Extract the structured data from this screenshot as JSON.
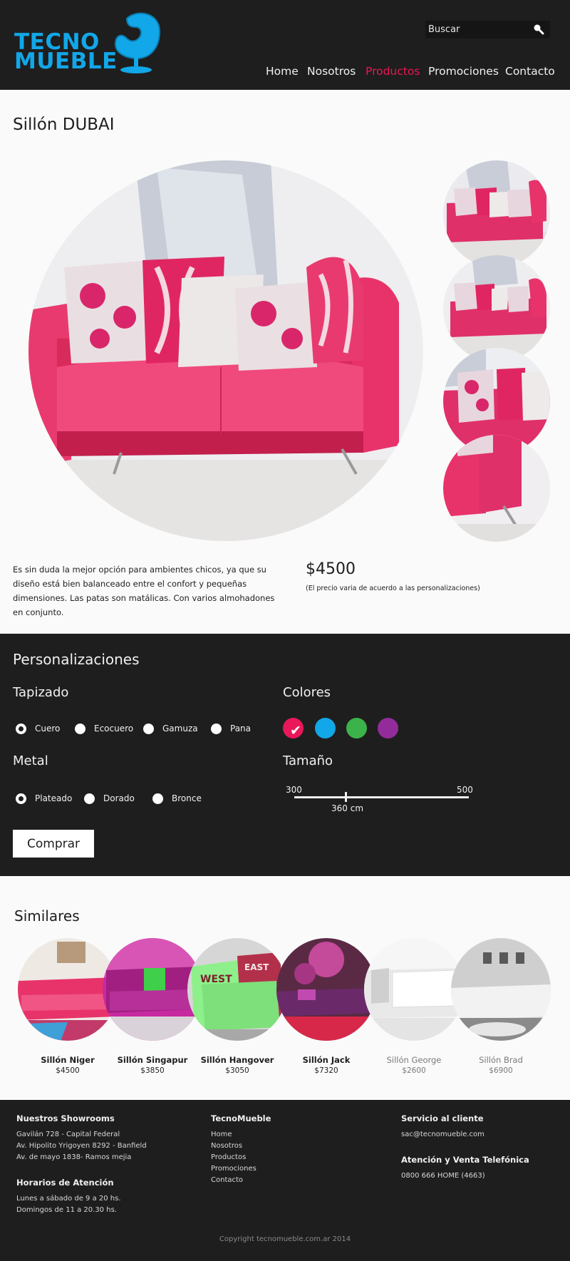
{
  "brand": {
    "logo_line1": "TECNO",
    "logo_line2": "MUEBLE",
    "logo_color": "#12a7e8"
  },
  "search": {
    "placeholder": "Buscar",
    "icon": "search-icon"
  },
  "nav": {
    "items": [
      {
        "label": "Home",
        "active": false
      },
      {
        "label": "Nosotros",
        "active": false
      },
      {
        "label": "Productos",
        "active": true
      },
      {
        "label": "Promociones",
        "active": false
      },
      {
        "label": "Contacto",
        "active": false
      }
    ],
    "active_color": "#e8184f"
  },
  "product": {
    "title": "Sillón DUBAI",
    "description": "Es sin duda la mejor opción para ambientes chicos, ya que su diseño está bien balanceado entre el confort y pequeñas dimensiones. Las patas son matálicas. Con varios almohadones en conjunto.",
    "price": "$4500",
    "price_note": "(El precio varia de acuerdo a las personalizaciones)"
  },
  "custom": {
    "title": "Personalizaciones",
    "tapizado": {
      "label": "Tapizado",
      "options": [
        "Cuero",
        "Ecocuero",
        "Gamuza",
        "Pana"
      ],
      "selected": "Cuero"
    },
    "colores": {
      "label": "Colores",
      "swatches": [
        "#e8185a",
        "#12a7e8",
        "#3bb34a",
        "#932c9a"
      ],
      "selected_index": 0,
      "check": "✔"
    },
    "metal": {
      "label": "Metal",
      "options": [
        "Plateado",
        "Dorado",
        "Bronce"
      ],
      "selected": "Plateado"
    },
    "tamano": {
      "label": "Tamaño",
      "min": "300",
      "max": "500",
      "value": "360 cm",
      "value_number": 360
    },
    "buy_label": "Comprar"
  },
  "similares": {
    "title": "Similares",
    "items": [
      {
        "name": "Sillón Niger",
        "price": "$4500"
      },
      {
        "name": "Sillón Singapur",
        "price": "$3850"
      },
      {
        "name": "Sillón Hangover",
        "price": "$3050"
      },
      {
        "name": "Sillón Jack",
        "price": "$7320"
      },
      {
        "name": "Sillón George",
        "price": "$2600"
      },
      {
        "name": "Sillón Brad",
        "price": "$6900"
      }
    ]
  },
  "footer": {
    "showrooms_title": "Nuestros Showrooms",
    "showrooms": [
      "Gavilán 728 - Capital Federal",
      "Av. Hipolito Yrigoyen 8292 - Banfield",
      "Av. de mayo 1838- Ramos mejia"
    ],
    "horarios_title": "Horarios de Atención",
    "horarios": [
      "Lunes a sábado de 9 a 20 hs.",
      "Domingos de 11 a 20.30 hs."
    ],
    "links_title": "TecnoMueble",
    "links": [
      "Home",
      "Nosotros",
      "Productos",
      "Promociones",
      "Contacto"
    ],
    "servicio_title": "Servicio al cliente",
    "servicio_email": "sac@tecnomueble.com",
    "telefonica_title": "Atención y Venta Telefónica",
    "telefonica_number": "0800 666 HOME (4663)",
    "copyright": "Copyright tecnomueble.com.ar 2014"
  }
}
